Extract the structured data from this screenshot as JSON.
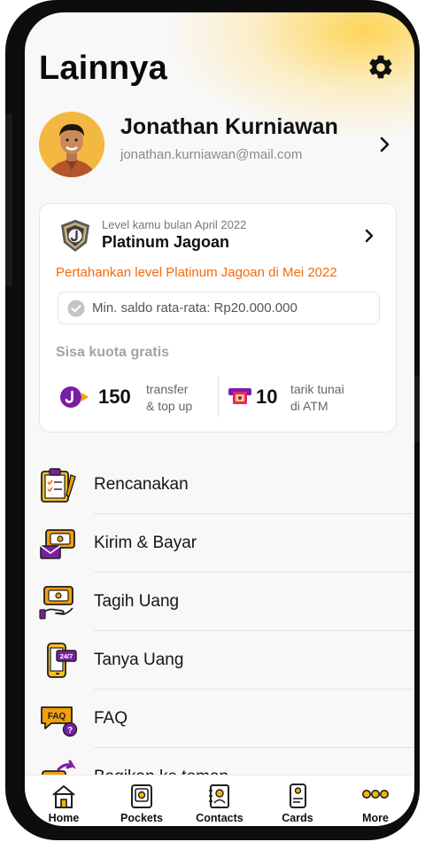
{
  "page": {
    "title": "Lainnya"
  },
  "profile": {
    "name": "Jonathan Kurniawan",
    "email": "jonathan.kurniawan@mail.com"
  },
  "level": {
    "caption": "Level kamu bulan April 2022",
    "name": "Platinum Jagoan",
    "keep_message": "Pertahankan level Platinum Jagoan di Mei 2022",
    "min_balance": "Min. saldo rata-rata: Rp20.000.000",
    "quota_title": "Sisa kuota gratis",
    "quota": [
      {
        "count": "150",
        "line1": "transfer",
        "line2": "& top up",
        "icon": "jago-transfer-icon"
      },
      {
        "count": "10",
        "line1": "tarik tunai",
        "line2": "di ATM",
        "icon": "atm-icon"
      }
    ]
  },
  "menu": [
    {
      "label": "Rencanakan",
      "icon": "planner-icon"
    },
    {
      "label": "Kirim & Bayar",
      "icon": "send-pay-icon"
    },
    {
      "label": "Tagih Uang",
      "icon": "request-money-icon"
    },
    {
      "label": "Tanya Uang",
      "icon": "phone-24-7-icon"
    },
    {
      "label": "FAQ",
      "icon": "faq-icon"
    },
    {
      "label": "Bagikan ke teman",
      "icon": "share-icon"
    }
  ],
  "tabs": [
    {
      "label": "Home",
      "icon": "home-icon"
    },
    {
      "label": "Pockets",
      "icon": "pockets-icon"
    },
    {
      "label": "Contacts",
      "icon": "contacts-icon"
    },
    {
      "label": "Cards",
      "icon": "cards-icon"
    },
    {
      "label": "More",
      "icon": "more-dots-icon",
      "active": true
    }
  ],
  "colors": {
    "accent_yellow": "#f7b500",
    "accent_orange": "#f36b0b",
    "jago_purple": "#7b1fa2",
    "icon_orange": "#f59e0b"
  }
}
